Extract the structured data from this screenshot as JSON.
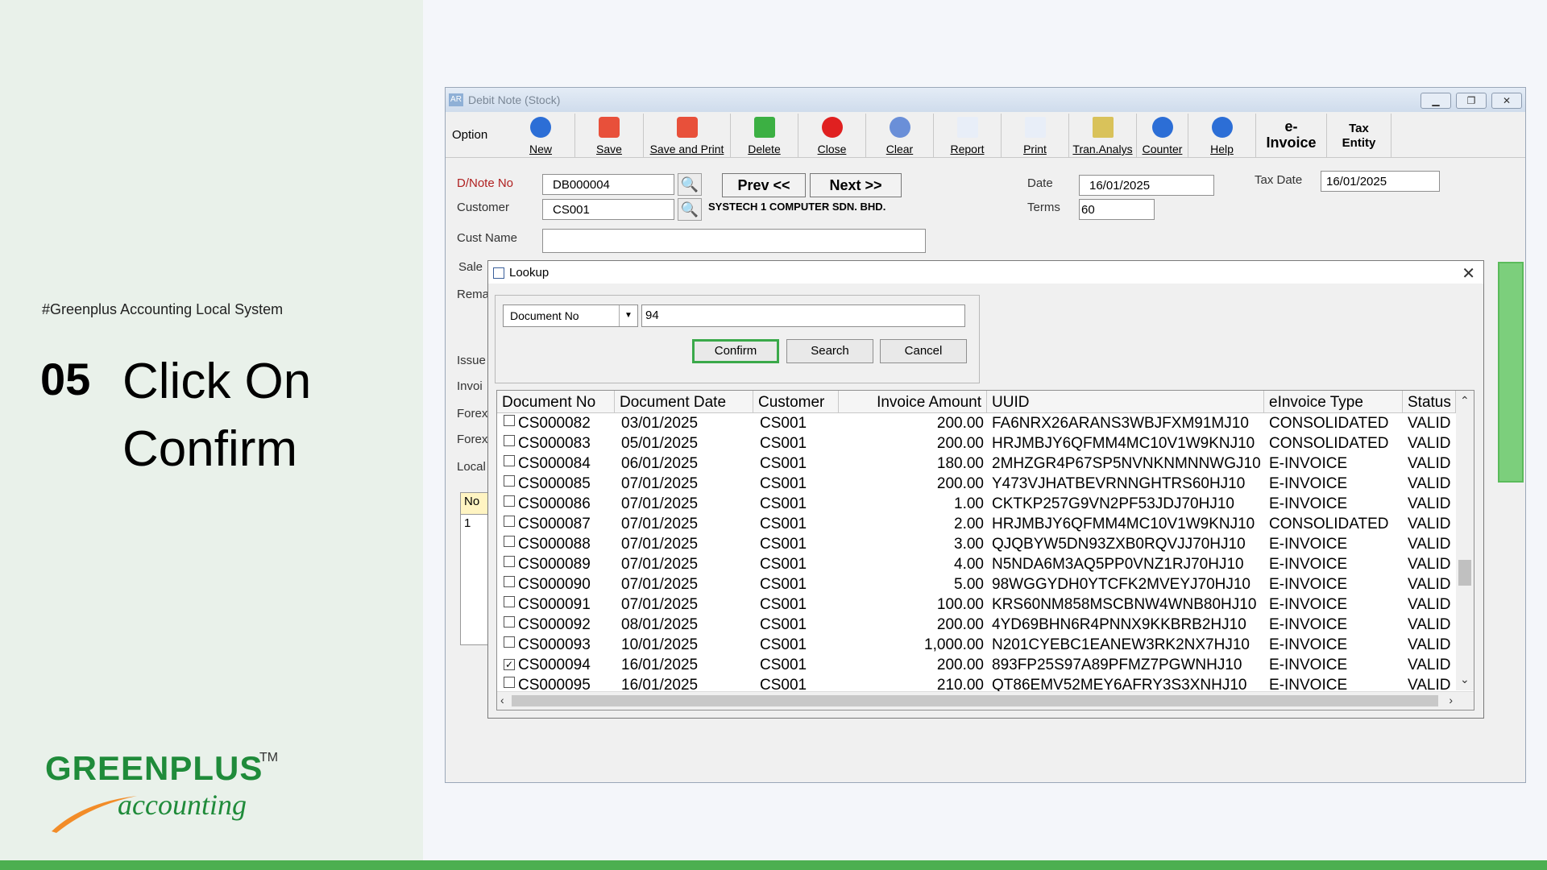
{
  "slide": {
    "hashtag": "#Greenplus Accounting Local System",
    "step_number": "05",
    "step_title": "Click On Confirm",
    "logo_main_a": "GREEN",
    "logo_main_b": "PLUS",
    "logo_tm": "TM",
    "logo_sub": "accounting",
    "brand_green": "#1f8b3a",
    "brand_orange": "#f28c28"
  },
  "window": {
    "title": "Debit Note (Stock)",
    "title_icon": "AR"
  },
  "toolbar": {
    "option": "Option",
    "items": [
      {
        "label": "New",
        "icon": "power-icon"
      },
      {
        "label": "Save",
        "icon": "save-icon"
      },
      {
        "label": "Save and Print",
        "icon": "save-print-icon"
      },
      {
        "label": "Delete",
        "icon": "delete-icon"
      },
      {
        "label": "Close",
        "icon": "close-icon"
      },
      {
        "label": "Clear",
        "icon": "clear-icon"
      },
      {
        "label": "Report",
        "icon": "report-icon"
      },
      {
        "label": "Print",
        "icon": "print-icon"
      },
      {
        "label": "Tran.Analys",
        "icon": "analysis-icon"
      },
      {
        "label": "Counter",
        "icon": "counter-icon"
      },
      {
        "label": "Help",
        "icon": "help-icon"
      }
    ],
    "einvoice_a": "e-",
    "einvoice_b": "Invoice",
    "tax_a": "Tax",
    "tax_b": "Entity"
  },
  "form": {
    "dnote_label": "D/Note No",
    "dnote_value": "DB000004",
    "customer_label": "Customer",
    "customer_value": "CS001",
    "cust_name_label": "Cust Name",
    "prev_label": "Prev <<",
    "next_label": "Next >>",
    "customer_name": "SYSTECH 1 COMPUTER SDN. BHD.",
    "date_label": "Date",
    "date_value": "16/01/2025",
    "terms_label": "Terms",
    "terms_value": "60",
    "taxdate_label": "Tax Date",
    "taxdate_value": "16/01/2025",
    "stubs": [
      "Sale",
      "Rema",
      "Issue",
      "Invoi",
      "Forex",
      "Forex",
      "Local"
    ],
    "no_header": "No",
    "no_value": "1"
  },
  "lookup": {
    "title": "Lookup",
    "field_selected": "Document No",
    "search_value": "94",
    "confirm_label": "Confirm",
    "search_label": "Search",
    "cancel_label": "Cancel",
    "columns": [
      "Document No",
      "Document Date",
      "Customer",
      "Invoice Amount",
      "UUID",
      "eInvoice Type",
      "Status"
    ],
    "rows": [
      {
        "checked": false,
        "doc": "CS000082",
        "date": "03/01/2025",
        "cust": "CS001",
        "amt": "200.00",
        "uuid": "FA6NRX26ARANS3WBJFXM91MJ10",
        "type": "CONSOLIDATED",
        "status": "VALID"
      },
      {
        "checked": false,
        "doc": "CS000083",
        "date": "05/01/2025",
        "cust": "CS001",
        "amt": "200.00",
        "uuid": "HRJMBJY6QFMM4MC10V1W9KNJ10",
        "type": "CONSOLIDATED",
        "status": "VALID"
      },
      {
        "checked": false,
        "doc": "CS000084",
        "date": "06/01/2025",
        "cust": "CS001",
        "amt": "180.00",
        "uuid": "2MHZGR4P67SP5NVNKNMNNWGJ10",
        "type": "E-INVOICE",
        "status": "VALID"
      },
      {
        "checked": false,
        "doc": "CS000085",
        "date": "07/01/2025",
        "cust": "CS001",
        "amt": "200.00",
        "uuid": "Y473VJHATBEVRNNGHTRS60HJ10",
        "type": "E-INVOICE",
        "status": "VALID"
      },
      {
        "checked": false,
        "doc": "CS000086",
        "date": "07/01/2025",
        "cust": "CS001",
        "amt": "1.00",
        "uuid": "CKTKP257G9VN2PF53JDJ70HJ10",
        "type": "E-INVOICE",
        "status": "VALID"
      },
      {
        "checked": false,
        "doc": "CS000087",
        "date": "07/01/2025",
        "cust": "CS001",
        "amt": "2.00",
        "uuid": "HRJMBJY6QFMM4MC10V1W9KNJ10",
        "type": "CONSOLIDATED",
        "status": "VALID"
      },
      {
        "checked": false,
        "doc": "CS000088",
        "date": "07/01/2025",
        "cust": "CS001",
        "amt": "3.00",
        "uuid": "QJQBYW5DN93ZXB0RQVJJ70HJ10",
        "type": "E-INVOICE",
        "status": "VALID"
      },
      {
        "checked": false,
        "doc": "CS000089",
        "date": "07/01/2025",
        "cust": "CS001",
        "amt": "4.00",
        "uuid": "N5NDA6M3AQ5PP0VNZ1RJ70HJ10",
        "type": "E-INVOICE",
        "status": "VALID"
      },
      {
        "checked": false,
        "doc": "CS000090",
        "date": "07/01/2025",
        "cust": "CS001",
        "amt": "5.00",
        "uuid": "98WGGYDH0YTCFK2MVEYJ70HJ10",
        "type": "E-INVOICE",
        "status": "VALID"
      },
      {
        "checked": false,
        "doc": "CS000091",
        "date": "07/01/2025",
        "cust": "CS001",
        "amt": "100.00",
        "uuid": "KRS60NM858MSCBNW4WNB80HJ10",
        "type": "E-INVOICE",
        "status": "VALID"
      },
      {
        "checked": false,
        "doc": "CS000092",
        "date": "08/01/2025",
        "cust": "CS001",
        "amt": "200.00",
        "uuid": "4YD69BHN6R4PNNX9KKBRB2HJ10",
        "type": "E-INVOICE",
        "status": "VALID"
      },
      {
        "checked": false,
        "doc": "CS000093",
        "date": "10/01/2025",
        "cust": "CS001",
        "amt": "1,000.00",
        "uuid": "N201CYEBC1EANEW3RK2NX7HJ10",
        "type": "E-INVOICE",
        "status": "VALID"
      },
      {
        "checked": true,
        "doc": "CS000094",
        "date": "16/01/2025",
        "cust": "CS001",
        "amt": "200.00",
        "uuid": "893FP25S97A89PFMZ7PGWNHJ10",
        "type": "E-INVOICE",
        "status": "VALID"
      },
      {
        "checked": false,
        "doc": "CS000095",
        "date": "16/01/2025",
        "cust": "CS001",
        "amt": "210.00",
        "uuid": "QT86EMV52MEY6AFRY3S3XNHJ10",
        "type": "E-INVOICE",
        "status": "VALID"
      }
    ]
  }
}
